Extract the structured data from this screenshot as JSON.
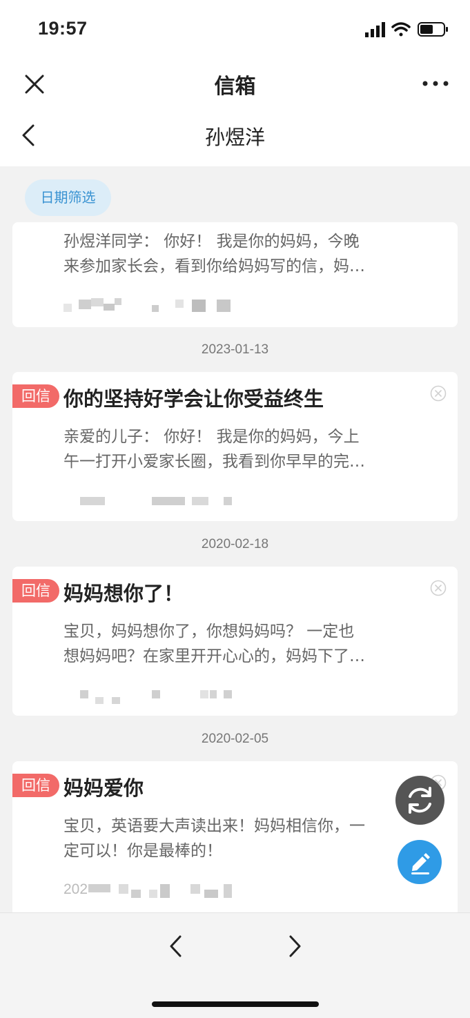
{
  "status_bar": {
    "time": "19:57"
  },
  "nav": {
    "title": "信箱",
    "subtitle": "孙煜洋"
  },
  "filter": {
    "label": "日期筛选"
  },
  "tag_label": "回信",
  "letters": [
    {
      "title": "",
      "preview_1": "孙煜洋同学： 你好！ 我是你的妈妈，今晚",
      "preview_2": "来参加家长会，看到你给妈妈写的信，妈…",
      "date_after": "2023-01-13"
    },
    {
      "title": "你的坚持好学会让你受益终生",
      "preview_1": "亲爱的儿子： 你好！ 我是你的妈妈，今上",
      "preview_2": "午一打开小爱家长圈，我看到你早早的完…",
      "date_after": "2020-02-18"
    },
    {
      "title": "妈妈想你了！",
      "preview_1": "宝贝，妈妈想你了，你想妈妈吗？ 一定也",
      "preview_2": "想妈妈吧？在家里开开心心的，妈妈下了…",
      "date_after": "2020-02-05"
    },
    {
      "title": "妈妈爱你",
      "preview_1": "宝贝，英语要大声读出来！妈妈相信你，一",
      "preview_2": "定可以！你是最棒的！",
      "meta_prefix": "202"
    }
  ],
  "colors": {
    "accent_blue": "#2f9be6",
    "reply_tag": "#f26a68",
    "filter_bg": "#dcedf8"
  },
  "icons": {
    "close": "close-icon",
    "more": "more-icon",
    "back": "chevron-left-icon",
    "refresh": "refresh-icon",
    "write": "edit-icon",
    "prev": "chevron-left-icon",
    "next": "chevron-right-icon"
  }
}
